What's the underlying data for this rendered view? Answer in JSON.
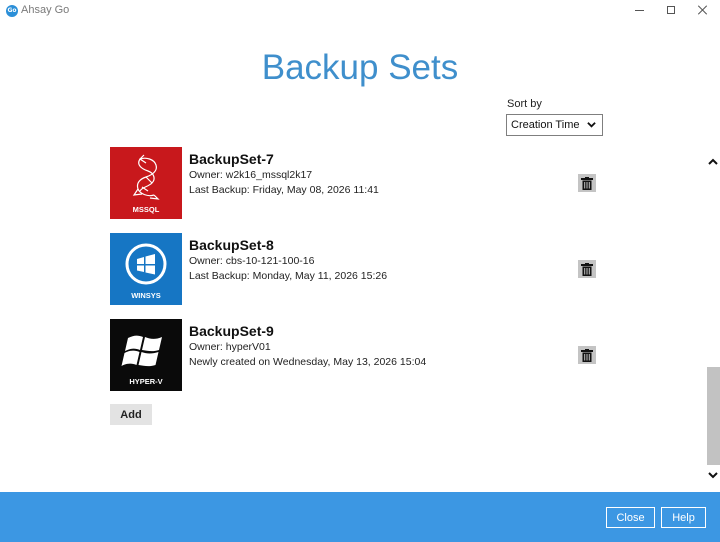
{
  "window": {
    "app_title": "Ahsay Go",
    "logo_text": "Go"
  },
  "page": {
    "title": "Backup Sets"
  },
  "sort": {
    "label": "Sort by",
    "selected": "Creation Time"
  },
  "backup_sets": [
    {
      "name": "BackupSet-7",
      "owner": "Owner: w2k16_mssql2k17",
      "status": "Last Backup: Friday, May 08, 2026 11:41",
      "tile_label": "MSSQL",
      "tile_color": "#c8181c",
      "icon": "mssql-icon"
    },
    {
      "name": "BackupSet-8",
      "owner": "Owner: cbs-10-121-100-16",
      "status": "Last Backup: Monday, May 11, 2026 15:26",
      "tile_label": "WINSYS",
      "tile_color": "#1676c4",
      "icon": "windows-system-icon"
    },
    {
      "name": "BackupSet-9",
      "owner": "Owner: hyperV01",
      "status": "Newly created on Wednesday, May 13, 2026 15:04",
      "tile_label": "HYPER-V",
      "tile_color": "#0a0a0a",
      "icon": "windows-icon"
    }
  ],
  "actions": {
    "add_label": "Add"
  },
  "footer": {
    "close_label": "Close",
    "help_label": "Help",
    "background": "#3c97e3"
  },
  "colors": {
    "title_accent": "#3f8fcc"
  }
}
